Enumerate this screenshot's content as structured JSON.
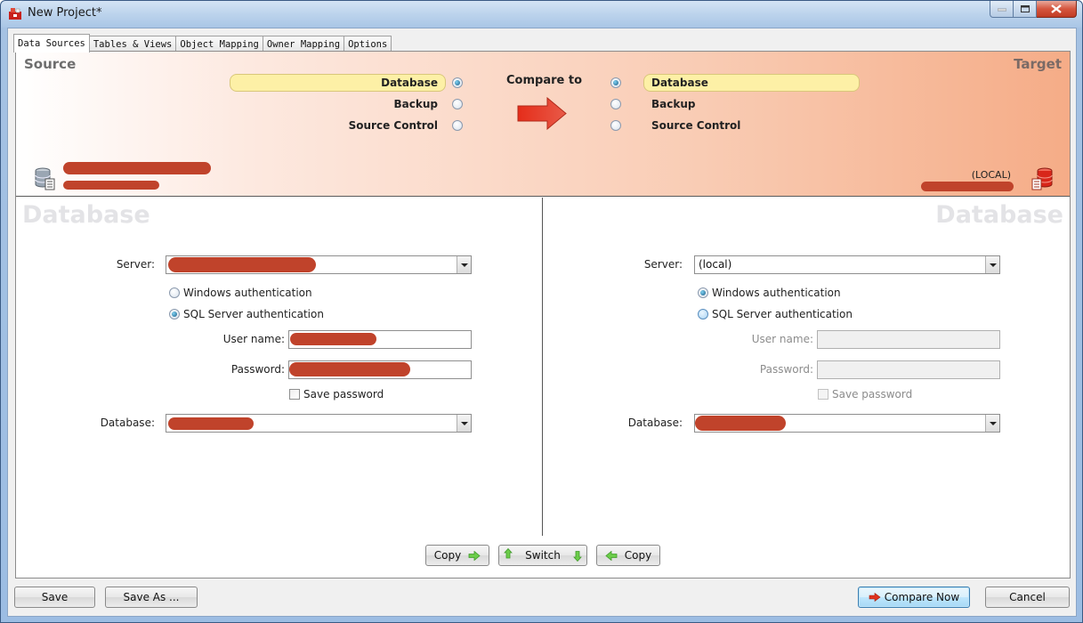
{
  "window": {
    "title": "New Project*",
    "controls": [
      "minimize",
      "maximize",
      "close"
    ]
  },
  "tabs": [
    {
      "label": "Data Sources",
      "active": true
    },
    {
      "label": "Tables & Views",
      "active": false
    },
    {
      "label": "Object Mapping",
      "active": false
    },
    {
      "label": "Owner Mapping",
      "active": false
    },
    {
      "label": "Options",
      "active": false
    }
  ],
  "header": {
    "source_label": "Source",
    "target_label": "Target",
    "compare_to": "Compare to",
    "source_options": [
      {
        "label": "Database",
        "selected": true
      },
      {
        "label": "Backup",
        "selected": false
      },
      {
        "label": "Source Control",
        "selected": false
      }
    ],
    "target_options": [
      {
        "label": "Database",
        "selected": true
      },
      {
        "label": "Backup",
        "selected": false
      },
      {
        "label": "Source Control",
        "selected": false
      }
    ],
    "target_server_caption": "(LOCAL)",
    "colors": {
      "band_start": "#ffffff",
      "band_end": "#f5ac87",
      "highlight": "#fdf0a6",
      "arrow": "#d93a22"
    }
  },
  "source": {
    "title": "Database",
    "server_label": "Server:",
    "server_value": "[redacted]",
    "auth_windows": "Windows authentication",
    "auth_sql": "SQL Server authentication",
    "auth_selected": "sql",
    "username_label": "User name:",
    "username_value": "[redacted]",
    "password_label": "Password:",
    "password_value": "[redacted]",
    "save_password_label": "Save password",
    "save_password_checked": false,
    "database_label": "Database:",
    "database_value": "[redacted]"
  },
  "target": {
    "title": "Database",
    "server_label": "Server:",
    "server_value": "(local)",
    "auth_windows": "Windows authentication",
    "auth_sql": "SQL Server authentication",
    "auth_selected": "windows",
    "username_label": "User name:",
    "username_value": "",
    "password_label": "Password:",
    "password_value": "",
    "save_password_label": "Save password",
    "save_password_checked": false,
    "database_label": "Database:",
    "database_value": "[redacted]"
  },
  "middle_buttons": {
    "copy_right": "Copy",
    "switch": "Switch",
    "copy_left": "Copy"
  },
  "footer": {
    "save": "Save",
    "save_as": "Save As ...",
    "compare_now": "Compare Now",
    "cancel": "Cancel"
  }
}
